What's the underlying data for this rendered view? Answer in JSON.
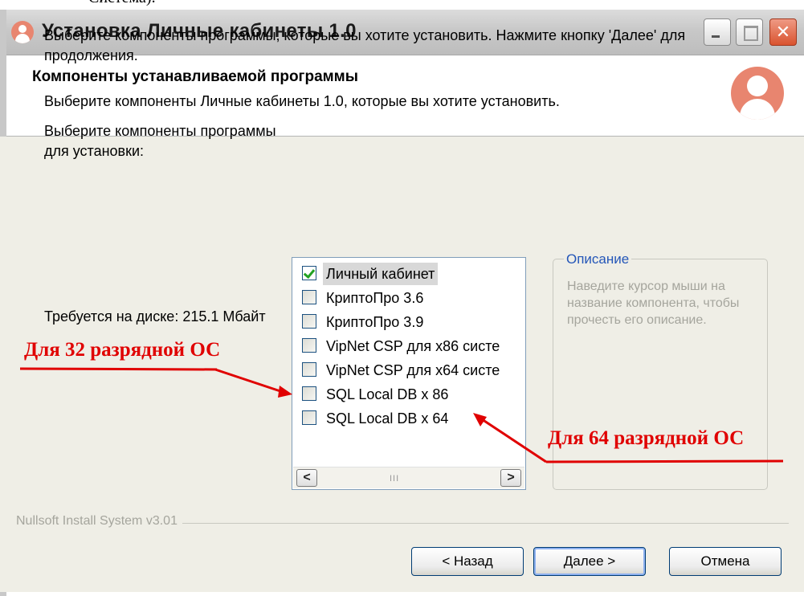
{
  "caption_fragment": "Система).",
  "window": {
    "title": "Установка Личные кабинеты 1.0",
    "controls": {
      "minimize": "_",
      "close": "✕"
    }
  },
  "header": {
    "title": "Компоненты устанавливаемой программы",
    "subtitle": "Выберите компоненты Личные кабинеты 1.0, которые вы хотите установить."
  },
  "main": {
    "intro": "Выберите компоненты программы, которые вы хотите установить. Нажмите кнопку 'Далее' для продолжения.",
    "select_label": "Выберите компоненты программы для установки:",
    "disk_label": "Требуется на диске: 215.1 Мбайт",
    "components": [
      {
        "label": "Личный кабинет",
        "checked": true
      },
      {
        "label": "КриптоПро 3.6",
        "checked": false
      },
      {
        "label": "КриптоПро 3.9",
        "checked": false
      },
      {
        "label": "VipNet CSP для x86 систе",
        "checked": false
      },
      {
        "label": "VipNet CSP для x64 систе",
        "checked": false
      },
      {
        "label": "SQL Local DB x 86",
        "checked": false
      },
      {
        "label": "SQL Local DB x 64",
        "checked": false
      }
    ],
    "scroll": {
      "left": "<",
      "right": ">",
      "grip": "III"
    },
    "description": {
      "legend": "Описание",
      "text": "Наведите курсор мыши на название компонента, чтобы прочесть его описание."
    }
  },
  "footer": {
    "brand": "Nullsoft Install System v3.01",
    "back": "< Назад",
    "next": "Далее >",
    "cancel": "Отмена"
  },
  "annotations": {
    "label_32": "Для 32 разрядной ОС",
    "label_64": "Для 64 разрядной ОС",
    "color": "#e00000"
  },
  "icons": [
    "installer-user-icon",
    "minimize-icon",
    "maximize-icon",
    "close-icon"
  ]
}
